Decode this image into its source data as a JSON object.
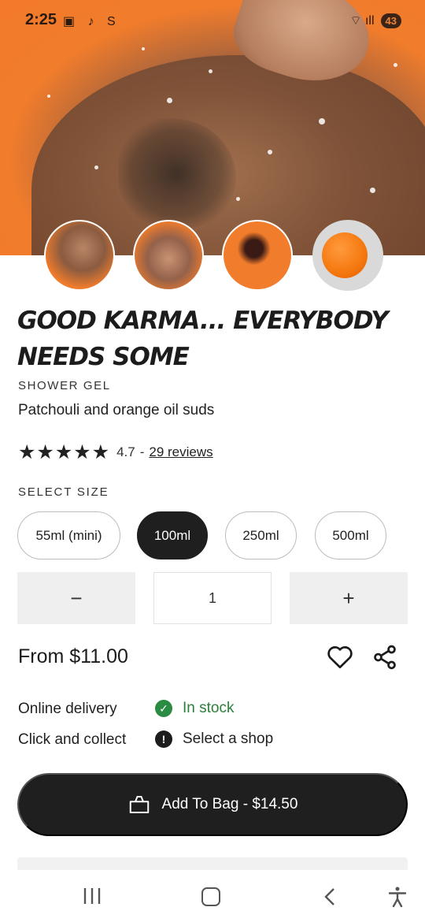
{
  "status_bar": {
    "time": "2:25",
    "icons": "▣ ♪ S",
    "signal": "⌔ ıll",
    "battery": "43"
  },
  "product": {
    "title": "Good Karma... Everybody Needs Some",
    "category": "SHOWER GEL",
    "subtitle": "Patchouli and orange oil suds",
    "rating": {
      "stars": "★★★★★",
      "score": "4.7",
      "separator": "-",
      "reviews": "29 reviews"
    },
    "select_size_label": "SELECT SIZE",
    "sizes": [
      {
        "label": "55ml (mini)",
        "selected": false
      },
      {
        "label": "100ml",
        "selected": true
      },
      {
        "label": "250ml",
        "selected": false
      },
      {
        "label": "500ml",
        "selected": false
      }
    ],
    "quantity": {
      "minus": "−",
      "value": "1",
      "plus": "+"
    },
    "price": "From $11.00"
  },
  "availability": {
    "online_label": "Online delivery",
    "online_status": "In stock",
    "collect_label": "Click and collect",
    "collect_status": "Select a shop"
  },
  "add_to_bag": {
    "label": "Add To Bag - $14.50"
  },
  "colors": {
    "accent_orange": "#f37a2a",
    "dark": "#1f1f1f",
    "in_stock_green": "#2a8c43"
  },
  "icons": [
    "heart-icon",
    "share-icon",
    "shopping-bag-icon",
    "check-circle-icon",
    "alert-circle-icon",
    "recent-apps-icon",
    "home-icon",
    "back-icon",
    "accessibility-icon"
  ]
}
